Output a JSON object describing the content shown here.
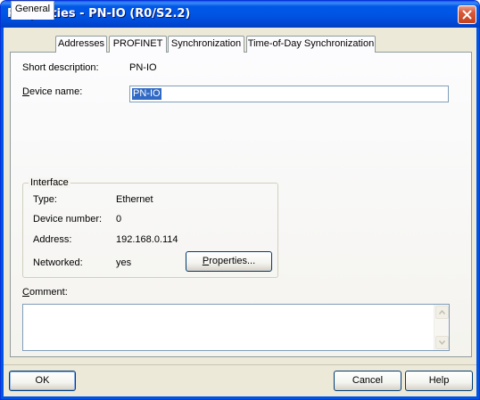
{
  "window": {
    "title": "Properties - PN-IO (R0/S2.2)"
  },
  "tabs": [
    {
      "label": "General",
      "active": true
    },
    {
      "label": "Addresses",
      "active": false
    },
    {
      "label": "PROFINET",
      "active": false
    },
    {
      "label": "Synchronization",
      "active": false
    },
    {
      "label": "Time-of-Day Synchronization",
      "active": false
    }
  ],
  "general": {
    "short_description_label": "Short description:",
    "short_description_value": "PN-IO",
    "device_name_label_mnemonic": "D",
    "device_name_label_rest": "evice name:",
    "device_name_value": "PN-IO"
  },
  "interface": {
    "title": "Interface",
    "type_label": "Type:",
    "type_value": "Ethernet",
    "device_number_label": "Device number:",
    "device_number_value": "0",
    "address_label": "Address:",
    "address_value": "192.168.0.114",
    "networked_label": "Networked:",
    "networked_value": "yes",
    "properties_button_mnemonic": "P",
    "properties_button_rest": "roperties..."
  },
  "comment": {
    "label_mnemonic": "C",
    "label_rest": "omment:",
    "value": ""
  },
  "footer": {
    "ok_label": "OK",
    "cancel_label": "Cancel",
    "help_label": "Help"
  },
  "colors": {
    "titlebar": "#0054e3",
    "dialog_bg": "#ece9d8",
    "selection": "#316ac5",
    "close_button": "#c4411d"
  }
}
